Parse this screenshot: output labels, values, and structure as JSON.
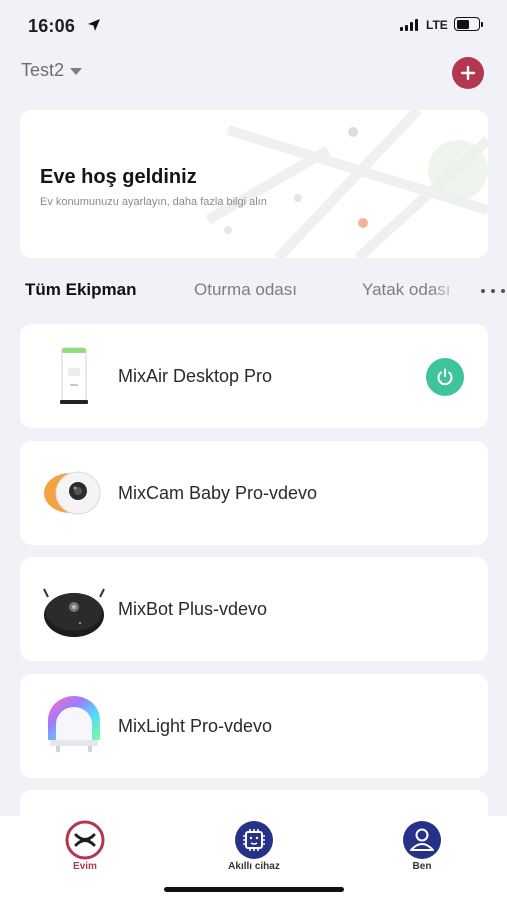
{
  "status_bar": {
    "time": "16:06",
    "network": "LTE",
    "battery_level": 0.6,
    "icons": [
      "location-arrow-icon",
      "signal-icon",
      "battery-icon"
    ]
  },
  "header": {
    "home_name": "Test2",
    "add_icon": "plus-icon",
    "colors": {
      "accent": "#b3374e"
    }
  },
  "welcome": {
    "title": "Eve hoş geldiniz",
    "subtitle": "Ev konumunuzu ayarlayın, daha fazla bilgi alın"
  },
  "tabs": [
    {
      "label": "Tüm Ekipman",
      "active": true
    },
    {
      "label": "Oturma odası",
      "active": false
    },
    {
      "label": "Yatak odası",
      "active": false
    }
  ],
  "devices": [
    {
      "name": "MixAir Desktop Pro",
      "icon": "air-purifier-icon",
      "power_button": true,
      "power_color": "#3fc39a"
    },
    {
      "name": "MixCam Baby Pro-vdevo",
      "icon": "baby-camera-icon",
      "power_button": false
    },
    {
      "name": "MixBot Plus-vdevo",
      "icon": "robot-vacuum-icon",
      "power_button": false
    },
    {
      "name": "MixLight Pro-vdevo",
      "icon": "smart-light-icon",
      "power_button": false
    }
  ],
  "bottom_nav": [
    {
      "label": "Evim",
      "icon": "home-logo-icon",
      "active": true,
      "color": "#b3374e"
    },
    {
      "label": "Akıllı cihaz",
      "icon": "chip-device-icon",
      "active": false,
      "color": "#26318a"
    },
    {
      "label": "Ben",
      "icon": "user-profile-icon",
      "active": false,
      "color": "#26318a"
    }
  ]
}
